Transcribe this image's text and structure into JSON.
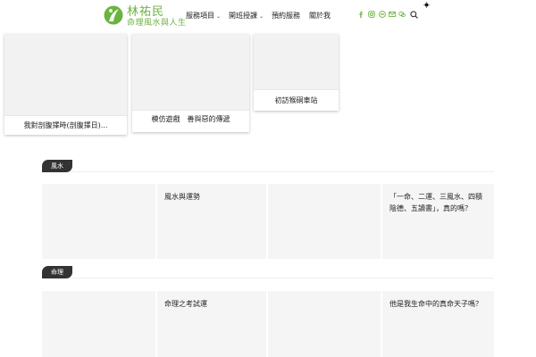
{
  "brand": {
    "name": "林祐民",
    "tagline": "命理風水與人生",
    "accent": "#6bb33f"
  },
  "nav": {
    "items": [
      {
        "label": "服務項目",
        "has_dropdown": true
      },
      {
        "label": "開班授課",
        "has_dropdown": true
      },
      {
        "label": "預約服務",
        "has_dropdown": false
      },
      {
        "label": "關於我",
        "has_dropdown": false
      }
    ],
    "caret": "⌄"
  },
  "social_icons": [
    "facebook-icon",
    "instagram-icon",
    "line-icon",
    "mail-icon",
    "wechat-icon"
  ],
  "top_cards": [
    {
      "title": "我對剖腹擇時(剖腹擇日)..."
    },
    {
      "title": "模仿遊戲　善與惡的傳遞"
    },
    {
      "title": "初訪猴硐車站"
    }
  ],
  "sections": [
    {
      "tag": "風水",
      "tiles": [
        {
          "title": ""
        },
        {
          "title": "風水與運勢"
        },
        {
          "title": ""
        },
        {
          "title": "「一命、二運、三風水、四積陰德、五讀書」，真的嗎？"
        }
      ]
    },
    {
      "tag": "命理",
      "tiles": [
        {
          "title": ""
        },
        {
          "title": "命理之考試運"
        },
        {
          "title": ""
        },
        {
          "title": "他是我生命中的真命天子嗎？"
        }
      ]
    }
  ]
}
